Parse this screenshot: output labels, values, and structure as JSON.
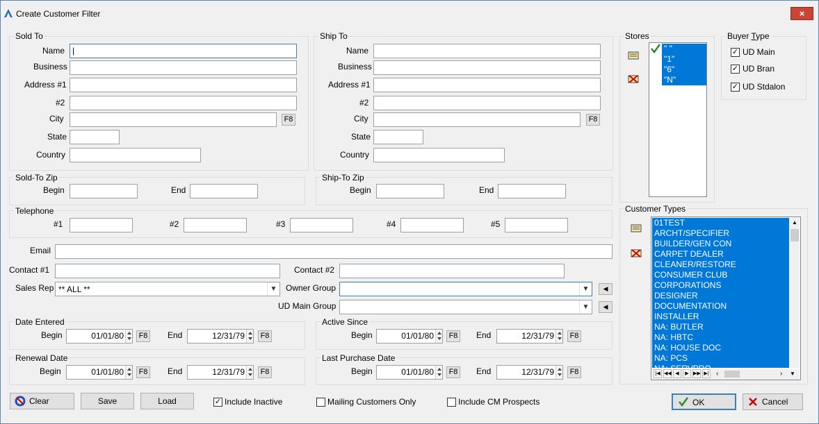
{
  "window": {
    "title": "Create Customer Filter",
    "close": "×"
  },
  "sold_to": {
    "group": "Sold To",
    "name_label": "Name",
    "business_label": "Business",
    "address1_label": "Address #1",
    "address2_label": "#2",
    "city_label": "City",
    "state_label": "State",
    "country_label": "Country",
    "f8": "F8",
    "name": "",
    "business": "",
    "address1": "",
    "address2": "",
    "city": "",
    "state": "",
    "country": ""
  },
  "ship_to": {
    "group": "Ship To",
    "name_label": "Name",
    "business_label": "Business",
    "address1_label": "Address #1",
    "address2_label": "#2",
    "city_label": "City",
    "state_label": "State",
    "country_label": "Country",
    "f8": "F8"
  },
  "stores": {
    "group": "Stores",
    "items": [
      "\" \"",
      "\"1\"",
      "\"6\"",
      "\"N\""
    ]
  },
  "buyer_type": {
    "group": "Buyer Type",
    "items": [
      {
        "label": "UD Main",
        "checked": true
      },
      {
        "label": "UD Bran",
        "checked": true
      },
      {
        "label": "UD Stdalon",
        "checked": true
      }
    ]
  },
  "sold_zip": {
    "group": "Sold-To Zip",
    "begin_label": "Begin",
    "end_label": "End"
  },
  "ship_zip": {
    "group": "Ship-To Zip",
    "begin_label": "Begin",
    "end_label": "End"
  },
  "telephone": {
    "group": "Telephone",
    "labels": [
      "#1",
      "#2",
      "#3",
      "#4",
      "#5"
    ]
  },
  "email_label": "Email",
  "contact1_label": "Contact #1",
  "contact2_label": "Contact #2",
  "sales_rep": {
    "label": "Sales Rep",
    "value": "** ALL **"
  },
  "owner_group": {
    "label": "Owner Group",
    "value": ""
  },
  "ud_main_group": {
    "label": "UD Main Group",
    "value": ""
  },
  "date_entered": {
    "group": "Date Entered",
    "begin_label": "Begin",
    "end_label": "End",
    "begin": "01/01/80",
    "end": "12/31/79",
    "f8": "F8"
  },
  "active_since": {
    "group": "Active Since",
    "begin_label": "Begin",
    "end_label": "End",
    "begin": "01/01/80",
    "end": "12/31/79",
    "f8": "F8"
  },
  "renewal_date": {
    "group": "Renewal Date",
    "begin_label": "Begin",
    "end_label": "End",
    "begin": "01/01/80",
    "end": "12/31/79",
    "f8": "F8"
  },
  "last_purchase": {
    "group": "Last Purchase Date",
    "begin_label": "Begin",
    "end_label": "End",
    "begin": "01/01/80",
    "end": "12/31/79",
    "f8": "F8"
  },
  "customer_types": {
    "group": "Customer Types",
    "items": [
      "01TEST",
      "ARCHT/SPECIFIER",
      "BUILDER/GEN CON",
      "CARPET DEALER",
      "CLEANER/RESTORE",
      "CONSUMER CLUB",
      "CORPORATIONS",
      "DESIGNER",
      "DOCUMENTATION",
      "INSTALLER",
      "NA: BUTLER",
      "NA: HBTC",
      "NA: HOUSE DOC",
      "NA: PCS",
      "NA: SERVPRO"
    ]
  },
  "footer": {
    "clear": "Clear",
    "save": "Save",
    "load": "Load",
    "include_inactive": "Include Inactive",
    "mailing_only": "Mailing Customers Only",
    "include_cm": "Include CM Prospects",
    "ok": "OK",
    "cancel": "Cancel"
  },
  "colors": {
    "selection": "#0078d7",
    "title_close": "#c94535"
  }
}
